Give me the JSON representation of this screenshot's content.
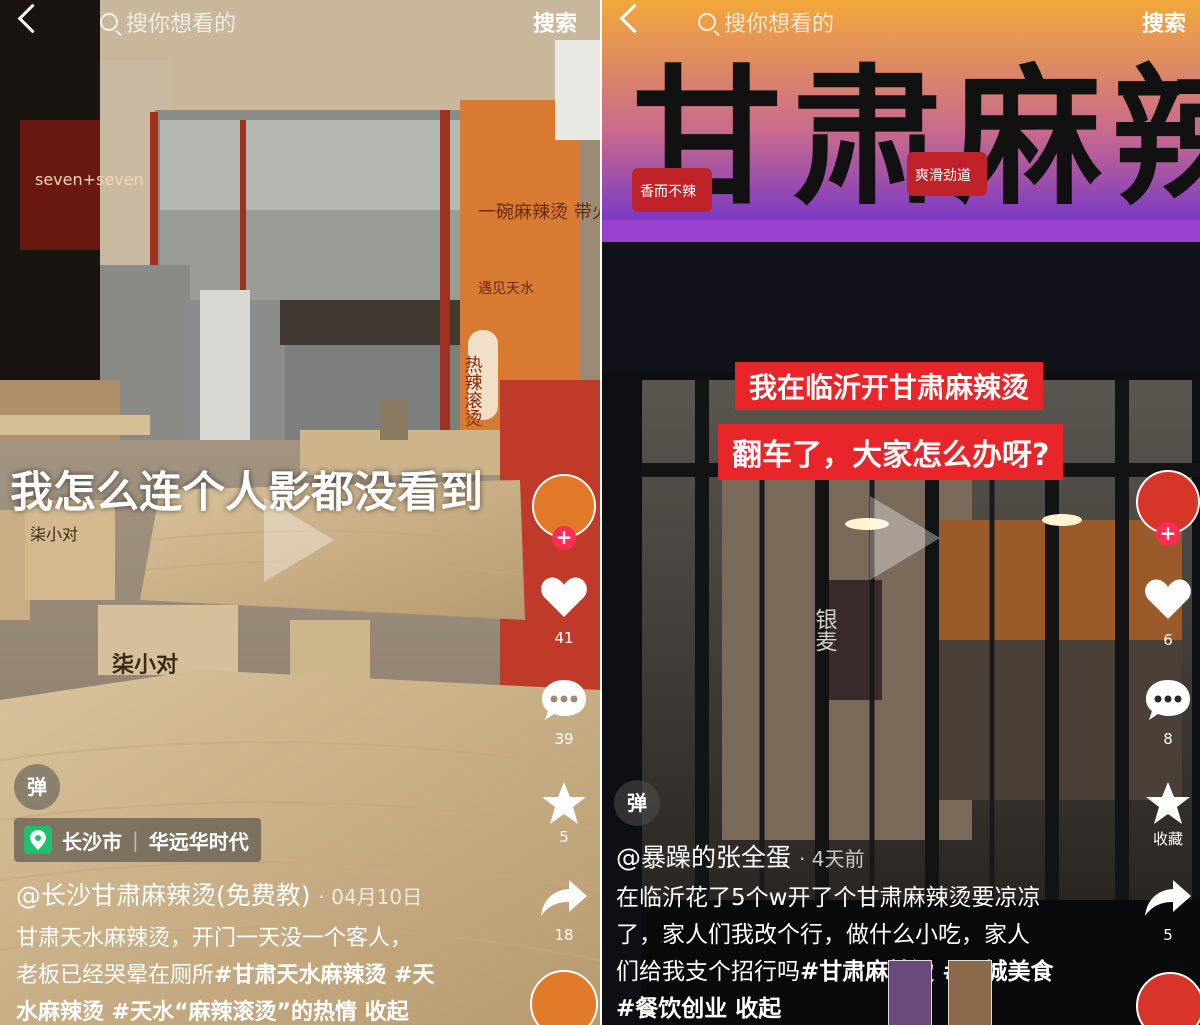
{
  "left": {
    "search_placeholder": "搜你想看的",
    "search_button": "搜索",
    "overlay_text": "我怎么连个人影都没看到",
    "likes": "41",
    "comments": "39",
    "favorites": "5",
    "shares": "18",
    "danmu_label": "弹",
    "location_city": "长沙市",
    "location_place": "华远华时代",
    "author": "@长沙甘肃麻辣烫(免费教)",
    "date": "· 04月10日",
    "desc_line1": "甘肃天水麻辣烫，开门一天没一个客人，",
    "desc_line2_plain": "老板已经哭晕在厕所",
    "desc_line2_tag": "#甘肃天水麻辣烫 #天",
    "desc_line3": "水麻辣烫 #天水“麻辣滚烫”的热情  收起",
    "scene_sign_1": "一碗麻辣烫 带火一座城",
    "scene_sign_2": "遇见天水",
    "scene_sign_3": "热辣滚烫",
    "scene_stool": "柒小对",
    "scene_stool_small": "柒小对",
    "scene_shop": "seven+seven"
  },
  "right": {
    "search_placeholder": "搜你想看的",
    "search_button": "搜索",
    "sign_text": "甘肃麻辣烫",
    "sign_badge_1": "香而不辣",
    "sign_badge_2": "爽滑劲道",
    "caption_line1": "我在临沂开甘肃麻辣烫",
    "caption_line2": "翻车了，大家怎么办呀?",
    "likes": "6",
    "comments": "8",
    "favorites": "收藏",
    "shares": "5",
    "danmu_label": "弹",
    "author": "@暴躁的张全蛋",
    "date": "· 4天前",
    "desc_line1": "在临沂花了5个w开了个甘肃麻辣烫要凉凉",
    "desc_line2": "了，家人们我改个行，做什么小吃，家人",
    "desc_line3_plain": "们给我支个招行吗",
    "desc_line3_tag": "#甘肃麻辣烫 #同城美食",
    "desc_line4": "#餐饮创业  收起",
    "scene_shop": "银麦"
  },
  "colors": {
    "like_red": "#ff2c55",
    "caption_red": "#e8262a",
    "location_green": "#1ec06a"
  }
}
